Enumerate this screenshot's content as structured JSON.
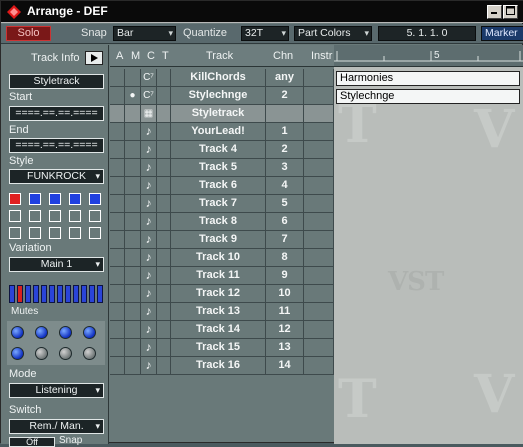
{
  "window": {
    "title": "Arrange - DEF"
  },
  "toolbar": {
    "solo": "Solo",
    "snap_label": "Snap",
    "snap_value": "Bar",
    "quantize_label": "Quantize",
    "quantize_value": "32T",
    "part_colors": "Part Colors",
    "position": "5.   1.   1.     0",
    "marker": "Marker"
  },
  "inspector": {
    "track_info": "Track Info",
    "track_name": "Styletrack",
    "start_label": "Start",
    "start_value": "====.==.==.====",
    "end_label": "End",
    "end_value": "====.==.==.====",
    "style_label": "Style",
    "style_value": "FUNKROCK",
    "variation_label": "Variation",
    "variation_value": "Main 1",
    "mutes_label": "Mutes",
    "mode_label": "Mode",
    "mode_value": "Listening",
    "switch_label": "Switch",
    "switch_value": "Rem./ Man.",
    "bottom_left": "Off",
    "bottom_right": "Snap"
  },
  "columns": {
    "a": "A",
    "m": "M",
    "c": "C",
    "t": "T",
    "track": "Track",
    "chn": "Chn",
    "instr": "Instr"
  },
  "ruler": {
    "mark": "5"
  },
  "tracks": [
    {
      "name": "KillChords",
      "chn": "any",
      "mute": "",
      "class": "c7"
    },
    {
      "name": "Stylechnge",
      "chn": "2",
      "mute": "●",
      "class": "c7"
    },
    {
      "name": "Styletrack",
      "chn": "",
      "mute": "",
      "class": "style"
    },
    {
      "name": "YourLead!",
      "chn": "1",
      "mute": "",
      "class": "note"
    },
    {
      "name": "Track 4",
      "chn": "2",
      "mute": "",
      "class": "note"
    },
    {
      "name": "Track 5",
      "chn": "3",
      "mute": "",
      "class": "note"
    },
    {
      "name": "Track 6",
      "chn": "4",
      "mute": "",
      "class": "note"
    },
    {
      "name": "Track 7",
      "chn": "5",
      "mute": "",
      "class": "note"
    },
    {
      "name": "Track 8",
      "chn": "6",
      "mute": "",
      "class": "note"
    },
    {
      "name": "Track 9",
      "chn": "7",
      "mute": "",
      "class": "note"
    },
    {
      "name": "Track 10",
      "chn": "8",
      "mute": "",
      "class": "note"
    },
    {
      "name": "Track 11",
      "chn": "9",
      "mute": "",
      "class": "note"
    },
    {
      "name": "Track 12",
      "chn": "10",
      "mute": "",
      "class": "note"
    },
    {
      "name": "Track 13",
      "chn": "11",
      "mute": "",
      "class": "note"
    },
    {
      "name": "Track 14",
      "chn": "12",
      "mute": "",
      "class": "note"
    },
    {
      "name": "Track 15",
      "chn": "13",
      "mute": "",
      "class": "note"
    },
    {
      "name": "Track 16",
      "chn": "14",
      "mute": "",
      "class": "note"
    }
  ],
  "parts": [
    {
      "label": "Harmonies",
      "row": 0
    },
    {
      "label": "Stylechnge",
      "row": 1
    }
  ],
  "watermark": "VST",
  "icons": {
    "c7": "C⁷",
    "style": "▦",
    "note": "♪"
  },
  "colors": {
    "solo": "#7a1818",
    "selected_row": "#8a9494",
    "row_bg": "#697979",
    "arrange_bg": "#b9bdba"
  }
}
